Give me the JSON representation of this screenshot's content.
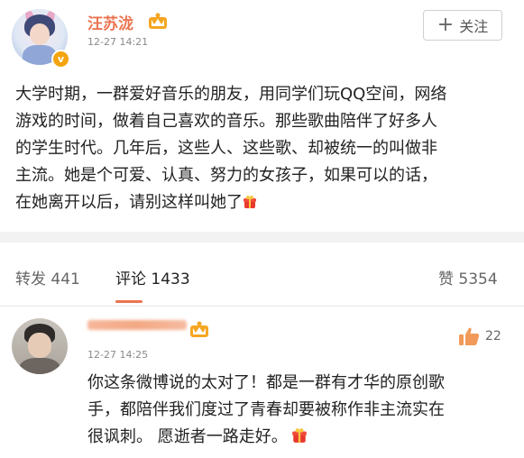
{
  "post": {
    "author": "汪苏泷",
    "time": "12-27 14:21",
    "follow_label": "关注",
    "follow_plus": "+",
    "verified_mark": "v",
    "text_lines": [
      "大学时期，一群爱好音乐的朋友，用同学们玩QQ空间，网络",
      "游戏的时间，做着自己喜欢的音乐。那些歌曲陪伴了好多人",
      "的学生时代。几年后，这些人、这些歌、却被统一的叫做非",
      "主流。她是个可爱、认真、努力的女孩子，如果可以的话，",
      "在她离开以后，请别这样叫她了"
    ]
  },
  "stats": {
    "repost_label": "转发",
    "repost_count": "441",
    "comment_label": "评论",
    "comment_count": "1433",
    "like_label": "赞",
    "like_count": "5354"
  },
  "comment": {
    "time": "12-27 14:25",
    "like_count": "22",
    "text_lines": [
      "你这条微博说的太对了！都是一群有才华的原创歌",
      "手，都陪伴我们度过了青春却要被称作非主流实在",
      "很讽刺。 愿逝者一路走好。"
    ]
  },
  "colors": {
    "accent": "#eb7350",
    "badge": "#f3a40f",
    "separator": "#f2f2f2"
  },
  "icons": [
    "crown-icon",
    "verified-badge-icon",
    "gift-emoji-icon",
    "thumbs-up-icon"
  ]
}
